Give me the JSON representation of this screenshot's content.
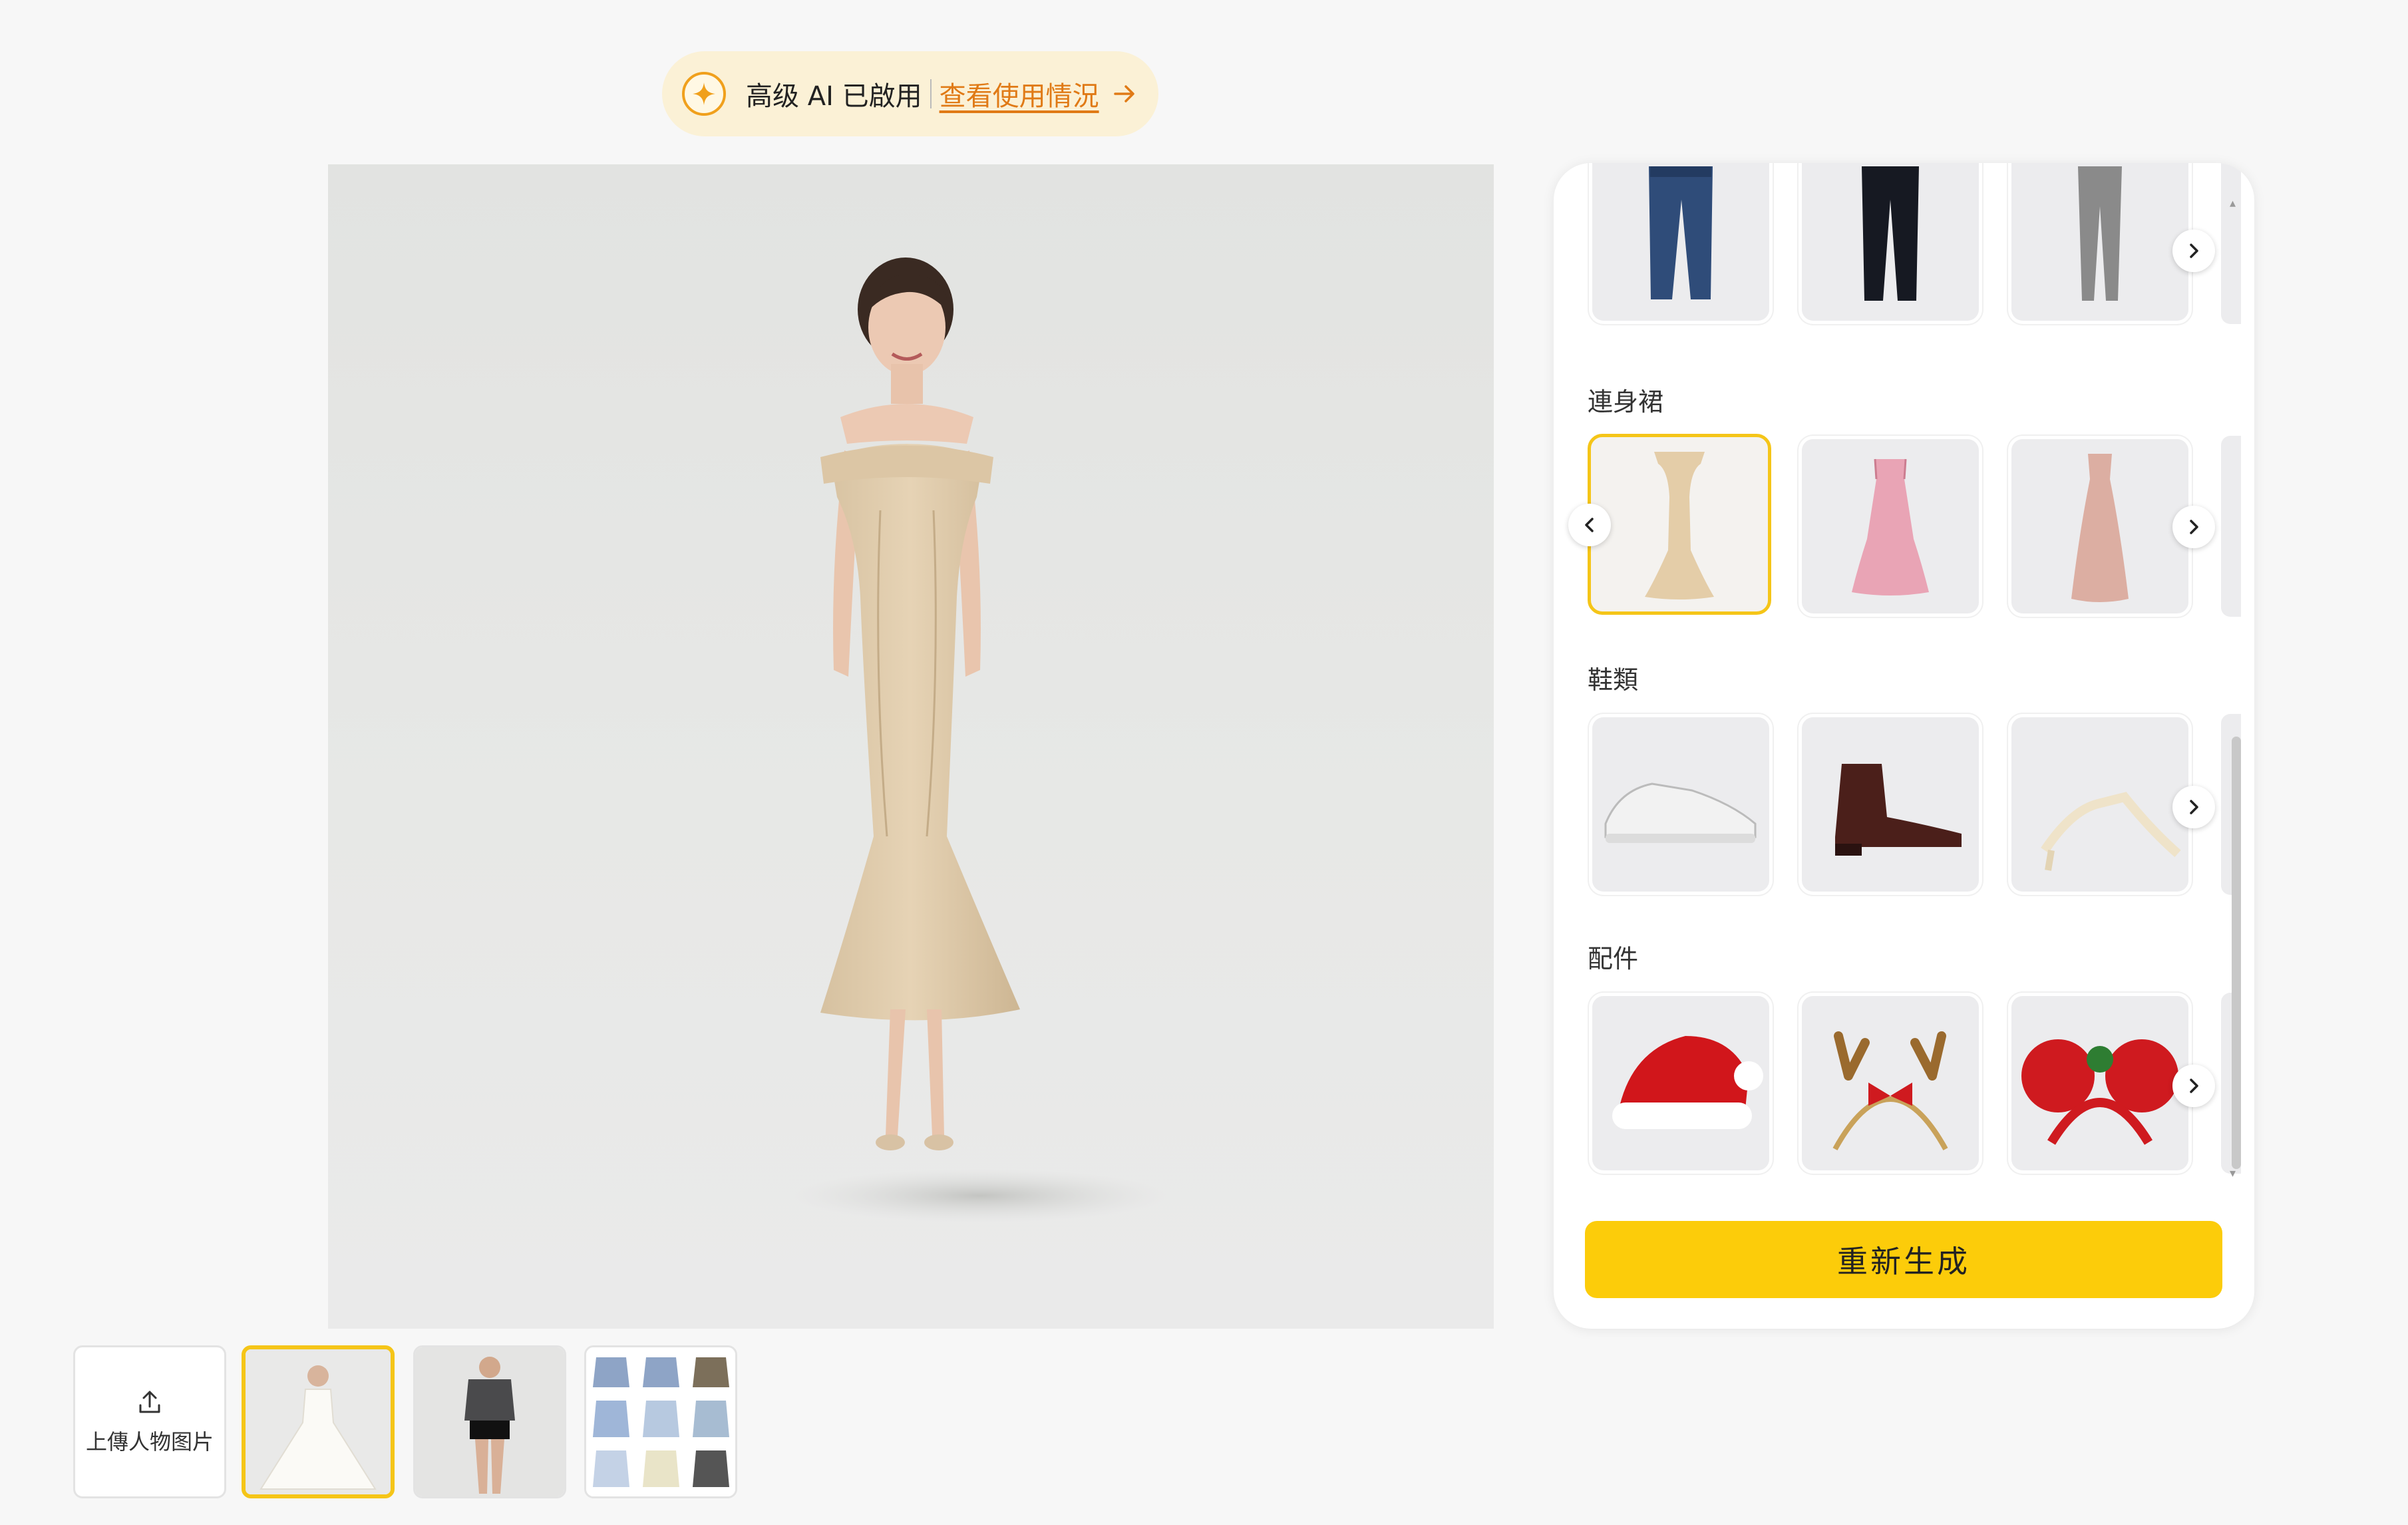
{
  "banner": {
    "ai_status": "高级 AI 已啟用",
    "link_text": "查看使用情況",
    "accent": "#e07a16",
    "icon": "sparkle-icon",
    "arrow_icon": "arrow-right-icon"
  },
  "main_image": {
    "alt": "穿米色一字肩連身裙的女士"
  },
  "panel": {
    "categories": [
      {
        "label": "",
        "items": [
          "藍色牛仔褲",
          "黑色長褲",
          "灰色緊身褲"
        ]
      },
      {
        "label": "連身裙",
        "items": [
          "米色一字肩魚尾裙",
          "粉紅吊帶短裙",
          "粉色緞面吊帶裙"
        ],
        "selected_index": 0
      },
      {
        "label": "鞋類",
        "items": [
          "白色運動鞋",
          "棕色切爾西靴",
          "米白高跟涼鞋"
        ]
      },
      {
        "label": "配件",
        "items": [
          "聖誕帽",
          "麋鹿角髮箍",
          "聖誕米妮髮箍"
        ]
      }
    ],
    "regenerate_label": "重新生成",
    "button_color": "#fccc0a"
  },
  "thumbnails": {
    "upload_label": "上傳人物图片",
    "upload_icon": "upload-icon",
    "selected_index": 0
  }
}
